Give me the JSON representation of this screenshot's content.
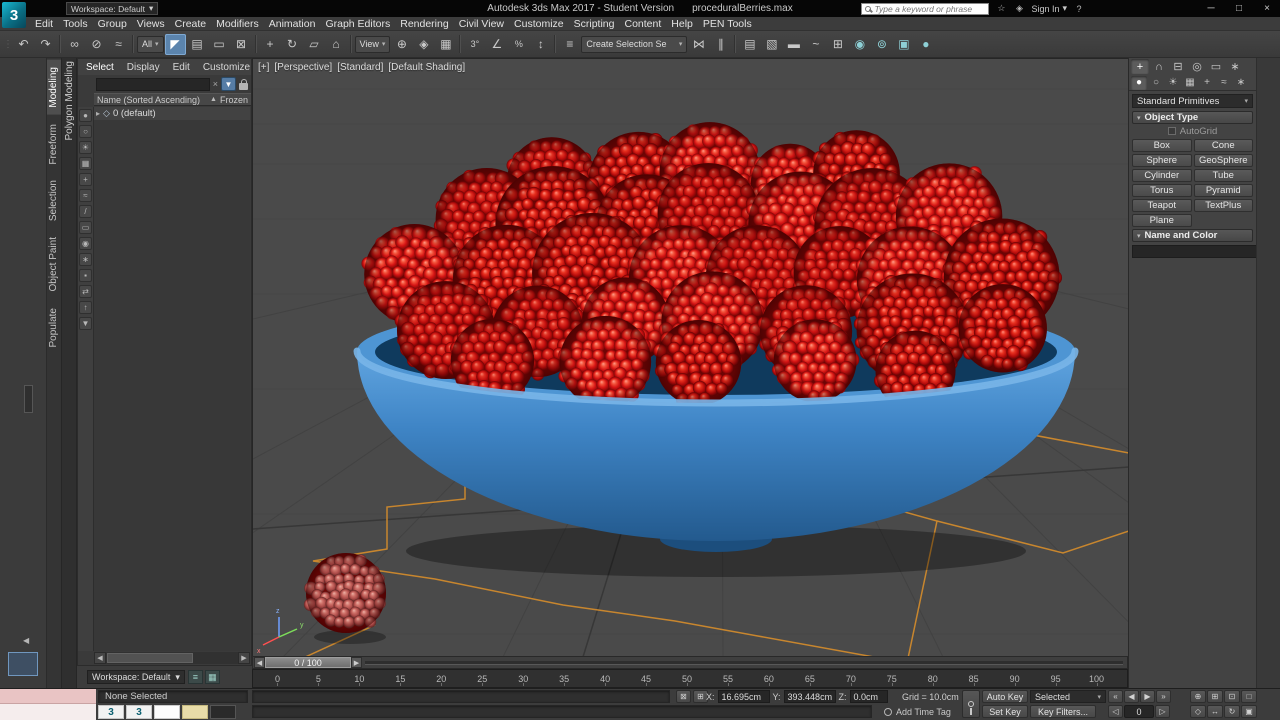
{
  "titlebar": {
    "logo": "3",
    "workspace_label": "Workspace: Default",
    "workspace_arrow": "▾",
    "title": "Autodesk 3ds Max 2017 - Student Version",
    "filename": "proceduralBerries.max",
    "search_placeholder": "Type a keyword or phrase",
    "icons": [
      {
        "name": "favorites-icon",
        "glyph": "☆"
      },
      {
        "name": "communication-center-icon",
        "glyph": "◈"
      }
    ],
    "sign_in": "Sign In",
    "sign_in_arrow": "▾",
    "help_glyph": "?",
    "window": {
      "minimize": "─",
      "maximize": "□",
      "close": "×"
    }
  },
  "menubar": {
    "items": [
      {
        "name": "menu-edit",
        "label": "Edit"
      },
      {
        "name": "menu-tools",
        "label": "Tools"
      },
      {
        "name": "menu-group",
        "label": "Group"
      },
      {
        "name": "menu-views",
        "label": "Views"
      },
      {
        "name": "menu-create",
        "label": "Create"
      },
      {
        "name": "menu-modifiers",
        "label": "Modifiers"
      },
      {
        "name": "menu-animation",
        "label": "Animation"
      },
      {
        "name": "menu-graph-editors",
        "label": "Graph Editors"
      },
      {
        "name": "menu-rendering",
        "label": "Rendering"
      },
      {
        "name": "menu-civil-view",
        "label": "Civil View"
      },
      {
        "name": "menu-customize",
        "label": "Customize"
      },
      {
        "name": "menu-scripting",
        "label": "Scripting"
      },
      {
        "name": "menu-content",
        "label": "Content"
      },
      {
        "name": "menu-help",
        "label": "Help"
      },
      {
        "name": "menu-pen-tools",
        "label": "PEN Tools"
      }
    ]
  },
  "toolbar": {
    "items": [
      {
        "name": "toolbar-grip",
        "glyph": "⋮",
        "cls": "grip",
        "inter": false
      },
      {
        "name": "undo-button",
        "glyph": "↶"
      },
      {
        "name": "redo-button",
        "glyph": "↷"
      },
      {
        "name": "toolbar-divider",
        "cls": "divider",
        "inter": false
      },
      {
        "name": "select-and-link-button",
        "glyph": "∞"
      },
      {
        "name": "unlink-selection-button",
        "glyph": "⊘"
      },
      {
        "name": "bind-to-space-warp-button",
        "glyph": "≈"
      },
      {
        "name": "toolbar-divider",
        "cls": "divider",
        "inter": false
      },
      {
        "name": "selection-filter-dropdown",
        "label": "All",
        "arrow": "▾",
        "cls": "dropdown"
      },
      {
        "name": "select-object-button",
        "glyph": "◤",
        "active": true
      },
      {
        "name": "select-by-name-button",
        "glyph": "▤"
      },
      {
        "name": "selection-region-button",
        "glyph": "▭"
      },
      {
        "name": "window-crossing-toggle",
        "glyph": "⊠"
      },
      {
        "name": "toolbar-divider",
        "cls": "divider",
        "inter": false
      },
      {
        "name": "select-and-move-button",
        "glyph": "+"
      },
      {
        "name": "select-and-rotate-button",
        "glyph": "↻"
      },
      {
        "name": "select-and-scale-button",
        "glyph": "▱"
      },
      {
        "name": "select-and-place-button",
        "glyph": "⌂"
      },
      {
        "name": "toolbar-divider",
        "cls": "divider",
        "inter": false
      },
      {
        "name": "reference-coordinate-dropdown",
        "label": "View",
        "arrow": "▾",
        "cls": "dropdown"
      },
      {
        "name": "use-pivot-point-button",
        "glyph": "⊕"
      },
      {
        "name": "select-and-manipulate-button",
        "glyph": "◈"
      },
      {
        "name": "keyboard-shortcut-override-toggle",
        "glyph": "▦"
      },
      {
        "name": "toolbar-divider",
        "cls": "divider",
        "inter": false
      },
      {
        "name": "snaps-toggle-3d",
        "glyph": "3°",
        "cls": "txt"
      },
      {
        "name": "angle-snap-toggle",
        "glyph": "∠"
      },
      {
        "name": "percent-snap-toggle",
        "glyph": "%",
        "cls": "txt"
      },
      {
        "name": "spinner-snap-toggle",
        "glyph": "↕"
      },
      {
        "name": "toolbar-divider",
        "cls": "divider",
        "inter": false
      },
      {
        "name": "edit-named-selection-sets-button",
        "glyph": "≡"
      },
      {
        "name": "named-selection-sets-dropdown",
        "label": "Create Selection Se",
        "arrow": "▾",
        "cls": "dropdown wide"
      },
      {
        "name": "mirror-button",
        "glyph": "⋈"
      },
      {
        "name": "align-button",
        "glyph": "∥"
      },
      {
        "name": "toolbar-divider",
        "cls": "divider",
        "inter": false
      },
      {
        "name": "toggle-scene-explorer-button",
        "glyph": "▤"
      },
      {
        "name": "toggle-layer-explorer-button",
        "glyph": "▧"
      },
      {
        "name": "toggle-ribbon-button",
        "glyph": "▬"
      },
      {
        "name": "curve-editor-button",
        "glyph": "~"
      },
      {
        "name": "schematic-view-button",
        "glyph": "⊞"
      },
      {
        "name": "material-editor-button",
        "glyph": "◉",
        "cls": "tint"
      },
      {
        "name": "render-setup-button",
        "glyph": "⊚",
        "cls": "tint"
      },
      {
        "name": "rendered-frame-window-button",
        "glyph": "▣",
        "cls": "tint"
      },
      {
        "name": "render-production-button",
        "glyph": "●",
        "cls": "tint"
      }
    ]
  },
  "ribbon": {
    "tabs": [
      {
        "name": "ribbon-tab-modeling",
        "label": "Modeling",
        "active": true
      },
      {
        "name": "ribbon-tab-freeform",
        "label": "Freeform"
      },
      {
        "name": "ribbon-tab-selection",
        "label": "Selection"
      },
      {
        "name": "ribbon-tab-object-paint",
        "label": "Object Paint"
      },
      {
        "name": "ribbon-tab-populate",
        "label": "Populate"
      }
    ],
    "panel_label": "Polygon Modeling"
  },
  "explorer": {
    "tabs": [
      {
        "name": "explorer-tab-select",
        "label": "Select",
        "active": true
      },
      {
        "name": "explorer-tab-display",
        "label": "Display"
      },
      {
        "name": "explorer-tab-edit",
        "label": "Edit"
      },
      {
        "name": "explorer-tab-customize",
        "label": "Customize"
      }
    ],
    "clear_glyph": "×",
    "filter_glyph": "▼",
    "columns": {
      "name": "Name (Sorted Ascending)",
      "sort": "▲",
      "frozen": "Frozen"
    },
    "rows": [
      {
        "name": "scene-explorer-row-default",
        "expander": "▸",
        "icon": "◇",
        "label": "0 (default)"
      }
    ],
    "tools": [
      {
        "name": "explorer-display-geometry-toggle",
        "glyph": "●"
      },
      {
        "name": "explorer-display-shapes-toggle",
        "glyph": "○"
      },
      {
        "name": "explorer-display-lights-toggle",
        "glyph": "☀"
      },
      {
        "name": "explorer-display-cameras-toggle",
        "glyph": "▦"
      },
      {
        "name": "explorer-display-helpers-toggle",
        "glyph": "+"
      },
      {
        "name": "explorer-display-space-warps-toggle",
        "glyph": "≈"
      },
      {
        "name": "explorer-display-bones-toggle",
        "glyph": "/"
      },
      {
        "name": "explorer-display-containers-toggle",
        "glyph": "▭"
      },
      {
        "name": "explorer-display-materials-toggle",
        "glyph": "◉"
      },
      {
        "name": "explorer-display-frozen-toggle",
        "glyph": "∗"
      },
      {
        "name": "explorer-lock-cell-editing-toggle",
        "glyph": "▪"
      },
      {
        "name": "explorer-sync-selection-toggle",
        "glyph": "⇄"
      },
      {
        "name": "explorer-pick-parent-button",
        "glyph": "↑"
      },
      {
        "name": "explorer-advanced-filter-button",
        "glyph": "▼"
      }
    ],
    "hscroll": {
      "left": "◀",
      "right": "▶"
    },
    "workspace_label": "Workspace: Default",
    "workspace_arrow": "▾",
    "workspace_buttons": [
      {
        "name": "explorer-config-button",
        "glyph": "≡"
      },
      {
        "name": "explorer-layout-button",
        "glyph": "▦"
      }
    ]
  },
  "viewport": {
    "labels": [
      {
        "name": "viewport-menu-plus",
        "label": "[+]"
      },
      {
        "name": "viewport-menu-pov",
        "label": "[Perspective]"
      },
      {
        "name": "viewport-menu-standard",
        "label": "[Standard]"
      },
      {
        "name": "viewport-menu-shading",
        "label": "[Default Shading]"
      }
    ],
    "colors": {
      "bg": "#4a4a4a",
      "grid": "#424242",
      "grid_dark": "#373737",
      "spline": "#c8862e",
      "bowl": "#4e95d3",
      "bowl_inner": "#0f3a5d",
      "bowl_front_top": "#61a5e0",
      "bowl_front_bottom": "#235a8e",
      "bowl_rim_highlight": "#79b5e8",
      "berry_dark": "#6f0505",
      "berry_mid": "#d61414",
      "berry_highlight": "#ff9d8c",
      "lone_berry": "#cf7068"
    }
  },
  "timeline": {
    "prev": "◀",
    "next": "▶",
    "slider_label": "0 / 100",
    "ticks": [
      "0",
      "5",
      "10",
      "15",
      "20",
      "25",
      "30",
      "35",
      "40",
      "45",
      "50",
      "55",
      "60",
      "65",
      "70",
      "75",
      "80",
      "85",
      "90",
      "95",
      "100"
    ]
  },
  "command_panel": {
    "tabs": [
      {
        "name": "panel-tab-create",
        "glyph": "+",
        "active": true
      },
      {
        "name": "panel-tab-modify",
        "glyph": "∩"
      },
      {
        "name": "panel-tab-hierarchy",
        "glyph": "⊟"
      },
      {
        "name": "panel-tab-motion",
        "glyph": "◎"
      },
      {
        "name": "panel-tab-display",
        "glyph": "▭"
      },
      {
        "name": "panel-tab-utilities",
        "glyph": "∗"
      }
    ],
    "categories": [
      {
        "name": "category-geometry",
        "glyph": "●",
        "active": true
      },
      {
        "name": "category-shapes",
        "glyph": "○"
      },
      {
        "name": "category-lights",
        "glyph": "☀"
      },
      {
        "name": "category-cameras",
        "glyph": "▦"
      },
      {
        "name": "category-helpers",
        "glyph": "+"
      },
      {
        "name": "category-space-warps",
        "glyph": "≈"
      },
      {
        "name": "category-systems",
        "glyph": "∗"
      }
    ],
    "dropdown_value": "Standard Primitives",
    "dropdown_arrow": "▾",
    "object_type": {
      "title": "Object Type",
      "arrow": "▾",
      "autogrid_label": "AutoGrid",
      "buttons": [
        {
          "l": "Box",
          "r": "Cone"
        },
        {
          "l": "Sphere",
          "r": "GeoSphere"
        },
        {
          "l": "Cylinder",
          "r": "Tube"
        },
        {
          "l": "Torus",
          "r": "Pyramid"
        },
        {
          "l": "Teapot",
          "r": "TextPlus"
        },
        {
          "l": "Plane",
          "r": ""
        }
      ]
    },
    "name_and_color": {
      "title": "Name and Color",
      "arrow": "▾",
      "name_value": "",
      "color": "#d92a8e"
    }
  },
  "statusbar": {
    "none_selected": "None Selected",
    "coord_icons": [
      {
        "name": "selection-lock-toggle",
        "glyph": "⊠"
      },
      {
        "name": "absolute-mode-toggle",
        "glyph": "⊞"
      }
    ],
    "x_label": "X:",
    "x_value": "16.695cm",
    "y_label": "Y:",
    "y_value": "393.448cm",
    "z_label": "Z:",
    "z_value": "0.0cm",
    "grid_label": "Grid = 10.0cm",
    "time_tag": "Add Time Tag",
    "auto_key": "Auto Key",
    "set_key": "Set Key",
    "key_mode": "Selected",
    "key_mode_arrow": "▾",
    "key_filters": "Key Filters...",
    "transport1": [
      {
        "name": "go-to-start-button",
        "glyph": "«"
      },
      {
        "name": "previous-frame-button",
        "glyph": "◀"
      },
      {
        "name": "play-animation-button",
        "glyph": "▶"
      },
      {
        "name": "go-to-end-button",
        "glyph": "»"
      }
    ],
    "transport2": [
      {
        "name": "previous-key-button",
        "glyph": "◁"
      },
      {
        "name": "current-frame-field",
        "glyph": "0",
        "cls": "field"
      },
      {
        "name": "next-key-button",
        "glyph": "▷"
      }
    ],
    "nav1": [
      {
        "name": "zoom-button",
        "glyph": "⊕"
      },
      {
        "name": "zoom-all-button",
        "glyph": "⊞"
      },
      {
        "name": "zoom-extents-button",
        "glyph": "⊡"
      },
      {
        "name": "zoom-region-button",
        "glyph": "□"
      }
    ],
    "nav2": [
      {
        "name": "field-of-view-button",
        "glyph": "◇"
      },
      {
        "name": "pan-view-button",
        "glyph": "↔"
      },
      {
        "name": "orbit-button",
        "glyph": "↻"
      },
      {
        "name": "maximize-viewport-toggle",
        "glyph": "▣"
      }
    ]
  },
  "taskbar": {
    "items": [
      {
        "name": "taskbar-3dsmax-1",
        "glyph": "3",
        "cls": "t-max"
      },
      {
        "name": "taskbar-3dsmax-2",
        "glyph": "3",
        "cls": "t-max"
      },
      {
        "name": "taskbar-document",
        "glyph": "",
        "cls": "t-doc"
      },
      {
        "name": "taskbar-folder",
        "glyph": "",
        "cls": "t-folder"
      },
      {
        "name": "taskbar-app",
        "glyph": "",
        "cls": "t-dark"
      }
    ]
  },
  "left_dock": {
    "collapse_arrow": "◀"
  }
}
